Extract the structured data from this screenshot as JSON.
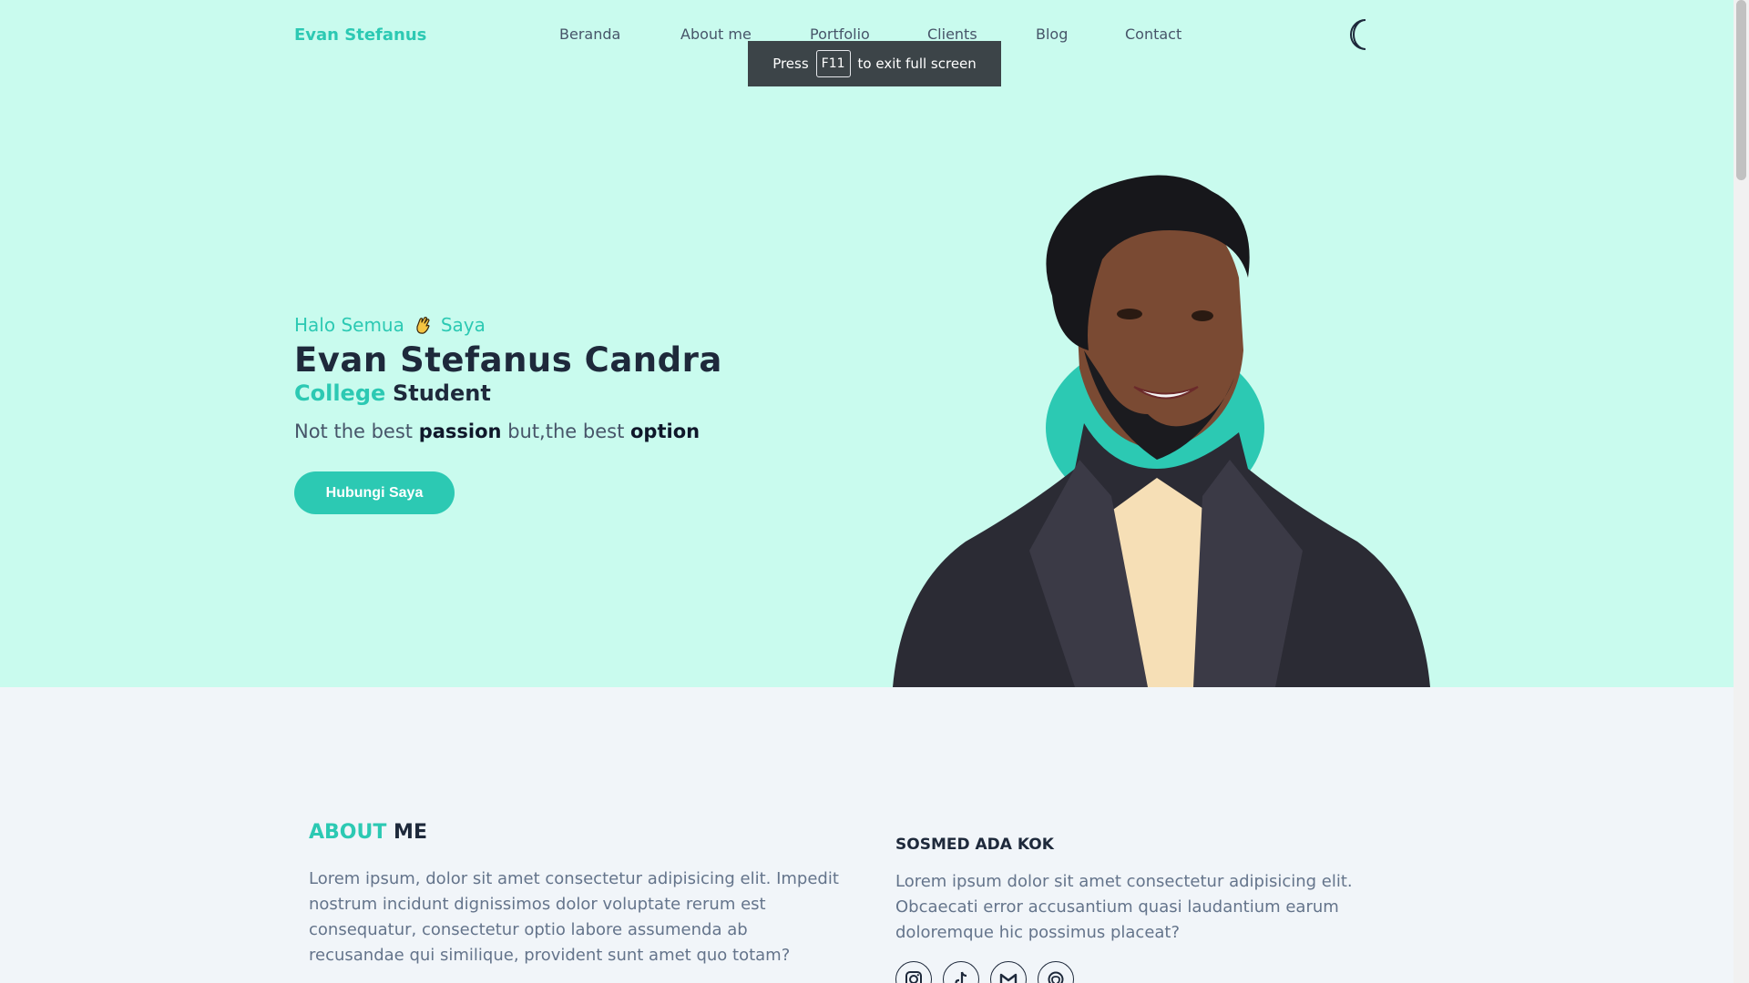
{
  "header": {
    "brand": "Evan Stefanus",
    "nav": [
      "Beranda",
      "About me",
      "Portfolio",
      "Clients",
      "Blog",
      "Contact"
    ],
    "theme_icon": "moon-icon"
  },
  "fullscreen_toast": {
    "before": "Press",
    "key": "F11",
    "after": "to exit full screen"
  },
  "hero": {
    "greeting_1": "Halo Semua",
    "greeting_icon": "waving-hand-icon",
    "greeting_2": "Saya",
    "name": "Evan Stefanus Candra",
    "role_1": "College",
    "role_2": "Student",
    "tag_1": "Not the best",
    "tag_2": "passion",
    "tag_3": "but,the best",
    "tag_4": "option",
    "cta": "Hubungi Saya"
  },
  "about": {
    "title_1": "ABOUT",
    "title_2": "ME",
    "body": "Lorem ipsum, dolor sit amet consectetur adipisicing elit. Impedit nostrum incidunt dignissimos dolor voluptate rerum est consequatur, consectetur optio labore assumenda ab recusandae qui similique, provident sunt amet quo totam?",
    "sosmed_title": "SOSMED ADA KOK",
    "sosmed_body": "Lorem ipsum dolor sit amet consectetur adipisicing elit. Obcaecati error accusantium quasi laudantium earum doloremque hic possimus placeat?",
    "socials": [
      "instagram-icon",
      "tiktok-icon",
      "gmail-icon",
      "github-icon"
    ]
  },
  "colors": {
    "accent": "#2cc9b3",
    "hero_bg": "#c9fbee",
    "section_bg": "#f1f5f9"
  }
}
